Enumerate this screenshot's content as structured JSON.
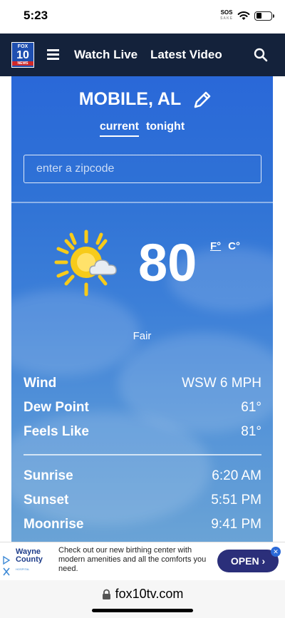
{
  "status_bar": {
    "time": "5:23",
    "sos_label": "SOS",
    "carrier_label": "SAKE"
  },
  "nav": {
    "logo_top": "FOX",
    "logo_number": "10",
    "logo_bottom": "NEWS",
    "watch_live": "Watch Live",
    "latest_video": "Latest Video"
  },
  "weather": {
    "city": "MOBILE, AL",
    "tabs": [
      {
        "label": "current",
        "active": true
      },
      {
        "label": "tonight",
        "active": false
      }
    ],
    "zip_placeholder": "enter a zipcode",
    "temperature": "80",
    "unit_f": "F°",
    "unit_c": "C°",
    "condition": "Fair",
    "conditions_icon": "partly-sunny-icon",
    "details": [
      {
        "label": "Wind",
        "value": "WSW 6 MPH"
      },
      {
        "label": "Dew Point",
        "value": "61°"
      },
      {
        "label": "Feels Like",
        "value": "81°"
      }
    ],
    "astronomy": [
      {
        "label": "Sunrise",
        "value": "6:20 AM"
      },
      {
        "label": "Sunset",
        "value": "5:51 PM"
      },
      {
        "label": "Moonrise",
        "value": "9:41 PM"
      }
    ]
  },
  "ad": {
    "advertiser": "Wayne County",
    "advertiser_sub": "HOSPITAL",
    "text": "Check out our new birthing center with modern amenities and all the comforts you need.",
    "cta": "OPEN ›"
  },
  "browser": {
    "url": "fox10tv.com"
  },
  "colors": {
    "nav_bg": "#14223b",
    "sky_top": "#2a68d8",
    "cta_bg": "#2b2f7a"
  }
}
